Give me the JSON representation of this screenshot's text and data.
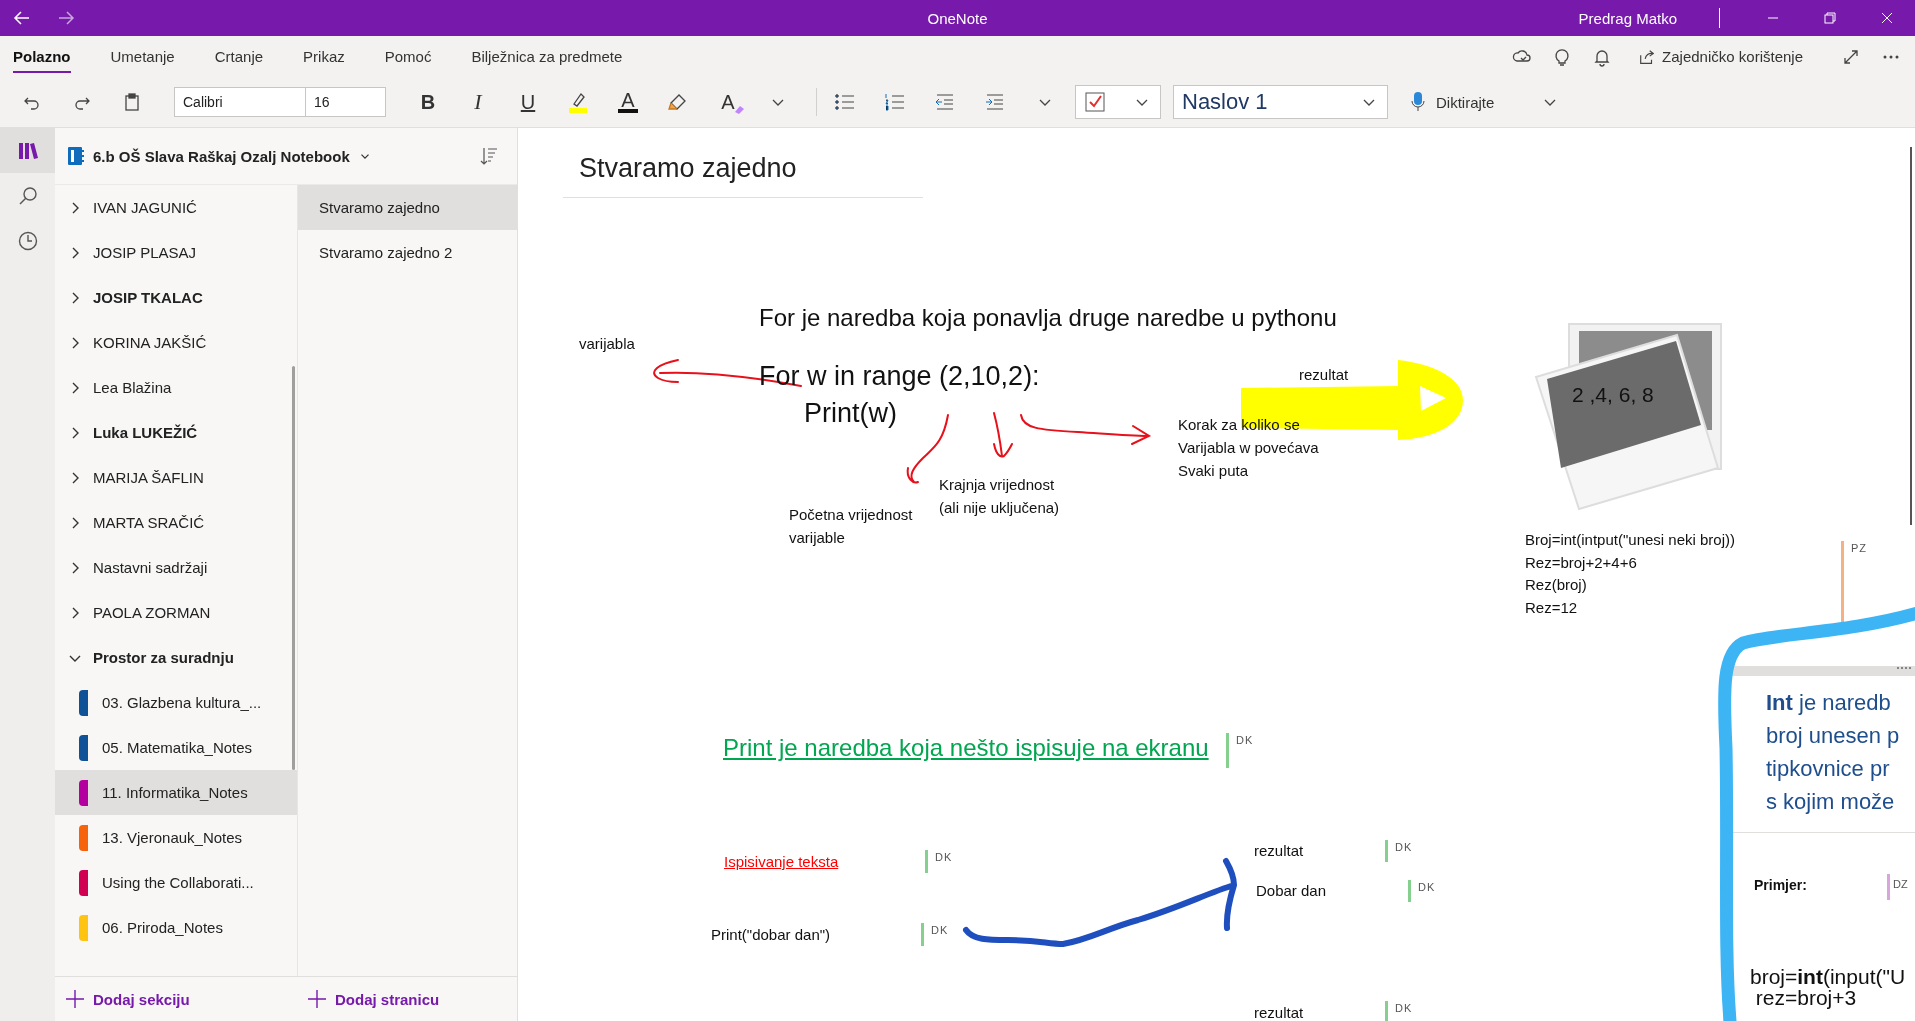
{
  "title_bar": {
    "title": "OneNote",
    "user": "Predrag Matko"
  },
  "ribbon": {
    "tabs": [
      {
        "label": "Polazno",
        "selected": true
      },
      {
        "label": "Umetanje",
        "selected": false
      },
      {
        "label": "Crtanje",
        "selected": false
      },
      {
        "label": "Prikaz",
        "selected": false
      },
      {
        "label": "Pomoć",
        "selected": false
      },
      {
        "label": "Bilježnica za predmete",
        "selected": false
      }
    ],
    "share": "Zajedničko korištenje",
    "font_family": "Calibri",
    "font_size": "16",
    "bold": "B",
    "italic": "I",
    "underline": "U",
    "font_color": "A",
    "styles": "A",
    "style_name": "Naslov 1",
    "dictate": "Diktirajte"
  },
  "notebook": {
    "name": "6.b OŠ Slava Raškaj Ozalj Notebook"
  },
  "sections": [
    {
      "name": "IVAN JAGUNIĆ",
      "unread": false,
      "expanded": false
    },
    {
      "name": "JOSIP PLASAJ",
      "unread": false,
      "expanded": false
    },
    {
      "name": "JOSIP TKALAC",
      "unread": true,
      "expanded": false
    },
    {
      "name": "KORINA JAKŠIĆ",
      "unread": false,
      "expanded": false
    },
    {
      "name": "Lea Blažina",
      "unread": false,
      "expanded": false
    },
    {
      "name": "Luka LUKEŽIĆ",
      "unread": true,
      "expanded": false
    },
    {
      "name": "MARIJA ŠAFLIN",
      "unread": false,
      "expanded": false
    },
    {
      "name": "MARTA SRAČIĆ",
      "unread": false,
      "expanded": false
    },
    {
      "name": "Nastavni sadržaji",
      "unread": false,
      "expanded": false
    },
    {
      "name": "PAOLA ZORMAN",
      "unread": false,
      "expanded": false
    },
    {
      "name": "Prostor za suradnju",
      "unread": true,
      "expanded": true,
      "children": [
        {
          "name": "03. Glazbena kultura_...",
          "color": "#0f5297",
          "selected": false
        },
        {
          "name": "05. Matematika_Notes",
          "color": "#0f5297",
          "selected": false
        },
        {
          "name": "11. Informatika_Notes",
          "color": "#b4009e",
          "selected": true
        },
        {
          "name": "13. Vjeronauk_Notes",
          "color": "#f7630c",
          "selected": false
        },
        {
          "name": "Using the Collaborati...",
          "color": "#d10050",
          "selected": false
        },
        {
          "name": "06. Priroda_Notes",
          "color": "#ffc412",
          "selected": false
        }
      ]
    }
  ],
  "pages": [
    {
      "title": "Stvaramo zajedno",
      "selected": true
    },
    {
      "title": "Stvaramo zajedno 2",
      "selected": false
    }
  ],
  "add_section": "Dodaj sekciju",
  "add_page": "Dodaj stranicu",
  "page": {
    "title": "Stvaramo zajedno",
    "notes": [
      {
        "kind": "label",
        "lines": [
          "varijabla"
        ]
      },
      {
        "kind": "statement",
        "lines": [
          "For je naredba koja ponavlja druge naredbe u pythonu"
        ]
      },
      {
        "kind": "code",
        "lines": [
          "For w in range (2,10,2):"
        ]
      },
      {
        "kind": "code",
        "lines": [
          "Print(w)"
        ]
      },
      {
        "kind": "label",
        "lines": [
          "rezultat"
        ]
      },
      {
        "kind": "label",
        "lines": [
          "Korak za koliko se",
          "Varijabla w povećava",
          "Svaki puta"
        ]
      },
      {
        "kind": "label",
        "lines": [
          "Krajnja vrijednost",
          "(ali nije uključena)"
        ]
      },
      {
        "kind": "label",
        "lines": [
          "Početna vrijednost",
          "varijable"
        ]
      },
      {
        "kind": "label",
        "lines": [
          "Broj=int(intput(\"unesi neki broj))",
          "Rez=broj+2+4+6",
          "Rez(broj)",
          "Rez=12"
        ],
        "tag": {
          "label": "PZ",
          "color": "#f4b183"
        }
      },
      {
        "kind": "green-heading",
        "lines": [
          "Print je naredba koja nešto ispisuje na ekranu"
        ],
        "tag": {
          "label": "DK",
          "color": "#86d08f"
        }
      },
      {
        "kind": "red-heading",
        "lines": [
          "Ispisivanje teksta"
        ],
        "tag": {
          "label": "DK",
          "color": "#86d08f"
        }
      },
      {
        "kind": "label",
        "lines": [
          "Print(\"dobar dan\")"
        ],
        "tag": {
          "label": "DK",
          "color": "#86d08f"
        }
      },
      {
        "kind": "label",
        "lines": [
          "rezultat"
        ],
        "tag": {
          "label": "DK",
          "color": "#86d08f"
        }
      },
      {
        "kind": "label",
        "lines": [
          "Dobar dan"
        ],
        "tag": {
          "label": "DK",
          "color": "#86d08f"
        }
      },
      {
        "kind": "label",
        "lines": [
          "rezultat"
        ],
        "tag": {
          "label": "DK",
          "color": "#86d08f"
        }
      }
    ],
    "picture_caption": "2 ,4, 6, 8",
    "container": {
      "paragraph": [
        "**Int** je naredb",
        "broj unesen p",
        "tipkovnice pr",
        "s kojim može"
      ],
      "example": "Primjer:",
      "example_tag": {
        "label": "DZ",
        "color": "#d8a6dc"
      },
      "code": [
        "broj=**int**(input(\"U",
        " rez=broj+3"
      ]
    }
  }
}
